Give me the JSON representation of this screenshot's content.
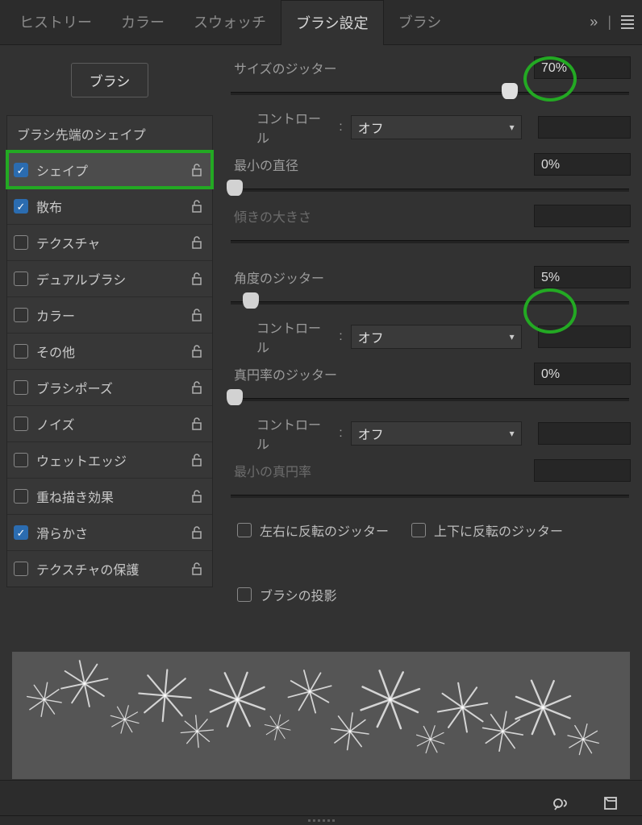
{
  "tabs": {
    "items": [
      "ヒストリー",
      "カラー",
      "スウォッチ",
      "ブラシ設定",
      "ブラシ"
    ],
    "active_index": 3,
    "expand_glyph": "»"
  },
  "sidebar": {
    "brush_button": "ブラシ",
    "header": "ブラシ先端のシェイプ",
    "items": [
      {
        "label": "シェイプ",
        "checked": true,
        "selected": true
      },
      {
        "label": "散布",
        "checked": true,
        "selected": false
      },
      {
        "label": "テクスチャ",
        "checked": false
      },
      {
        "label": "デュアルブラシ",
        "checked": false
      },
      {
        "label": "カラー",
        "checked": false
      },
      {
        "label": "その他",
        "checked": false
      },
      {
        "label": "ブラシポーズ",
        "checked": false
      },
      {
        "label": "ノイズ",
        "checked": false
      },
      {
        "label": "ウェットエッジ",
        "checked": false
      },
      {
        "label": "重ね描き効果",
        "checked": false
      },
      {
        "label": "滑らかさ",
        "checked": true
      },
      {
        "label": "テクスチャの保護",
        "checked": false
      }
    ]
  },
  "panel": {
    "size_jitter": {
      "label": "サイズのジッター",
      "value": "70%",
      "pos": 70
    },
    "size_control": {
      "label": "コントロール",
      "sep": ":",
      "value": "オフ"
    },
    "min_diameter": {
      "label": "最小の直径",
      "value": "0%",
      "pos": 0
    },
    "tilt_scale": {
      "label": "傾きの大きさ",
      "value": "",
      "pos": 0,
      "dim": true
    },
    "angle_jitter": {
      "label": "角度のジッター",
      "value": "5%",
      "pos": 5
    },
    "angle_control": {
      "label": "コントロール",
      "sep": ":",
      "value": "オフ"
    },
    "round_jitter": {
      "label": "真円率のジッター",
      "value": "0%",
      "pos": 0
    },
    "round_control": {
      "label": "コントロール",
      "sep": ":",
      "value": "オフ"
    },
    "min_roundness": {
      "label": "最小の真円率",
      "value": "",
      "pos": null,
      "dim": true
    },
    "flip_x": {
      "label": "左右に反転のジッター",
      "checked": false
    },
    "flip_y": {
      "label": "上下に反転のジッター",
      "checked": false
    },
    "brush_proj": {
      "label": "ブラシの投影",
      "checked": false
    }
  }
}
